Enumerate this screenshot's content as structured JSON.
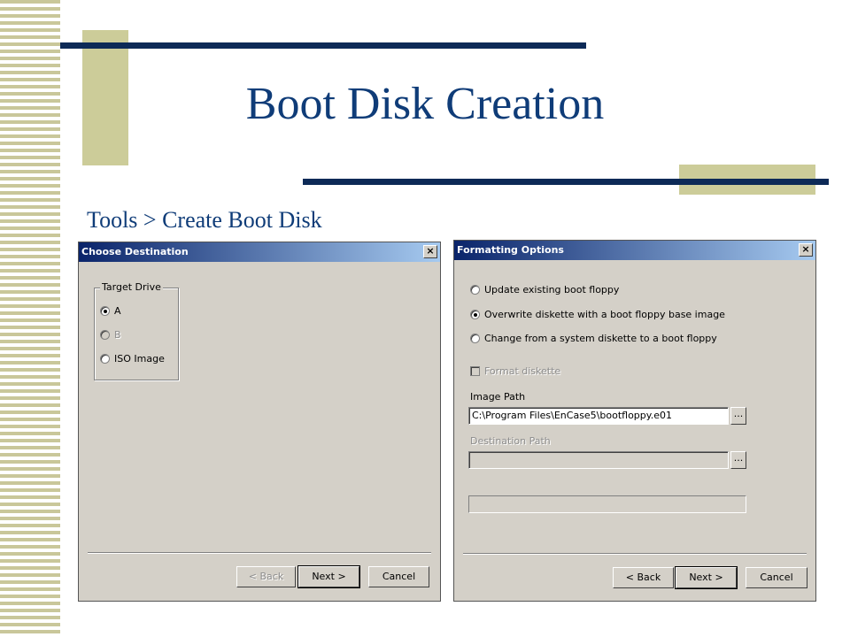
{
  "slide": {
    "title": "Boot Disk Creation",
    "subtitle": "Tools > Create Boot Disk"
  },
  "colors": {
    "title_blue": "#0f3c78",
    "bar_navy": "#0d2a57",
    "accent_khaki": "#cccc99",
    "dialog_gray": "#d4d0c8"
  },
  "choose_destination": {
    "title": "Choose Destination",
    "close_label": "×",
    "group_label": "Target Drive",
    "options": [
      {
        "label": "A",
        "checked": true,
        "enabled": true
      },
      {
        "label": "B",
        "checked": false,
        "enabled": false
      },
      {
        "label": "ISO Image",
        "checked": false,
        "enabled": true
      }
    ],
    "buttons": {
      "back": "< Back",
      "next": "Next >",
      "cancel": "Cancel"
    }
  },
  "formatting_options": {
    "title": "Formatting Options",
    "close_label": "×",
    "options": [
      {
        "label": "Update existing boot floppy",
        "checked": false
      },
      {
        "label": "Overwrite diskette with a boot floppy base image",
        "checked": true
      },
      {
        "label": "Change from a system diskette to a boot floppy",
        "checked": false
      }
    ],
    "format_checkbox_label": "Format diskette",
    "image_path_label": "Image Path",
    "image_path_value": "C:\\Program Files\\EnCase5\\bootfloppy.e01",
    "destination_path_label": "Destination Path",
    "destination_path_value": "",
    "browse_label": "...",
    "buttons": {
      "back": "< Back",
      "next": "Next >",
      "cancel": "Cancel"
    }
  }
}
